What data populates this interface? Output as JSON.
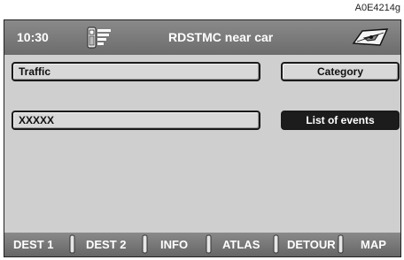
{
  "figure_ref": "A0E4214g",
  "header": {
    "time": "10:30",
    "title": "RDSTMC near car",
    "icons": [
      "phone-signal-icon",
      "navigation-map-icon"
    ]
  },
  "main": {
    "traffic_label": "Traffic",
    "event_field": "XXXXX",
    "category_button": "Category",
    "list_events_button": "List of events"
  },
  "bottom_bar": {
    "items": [
      "DEST 1",
      "DEST 2",
      "INFO",
      "ATLAS",
      "DETOUR",
      "MAP"
    ]
  },
  "colors": {
    "bar_bg": "#777777",
    "screen_bg": "#cfcfcf",
    "selected_button_bg": "#1c1c1c"
  }
}
